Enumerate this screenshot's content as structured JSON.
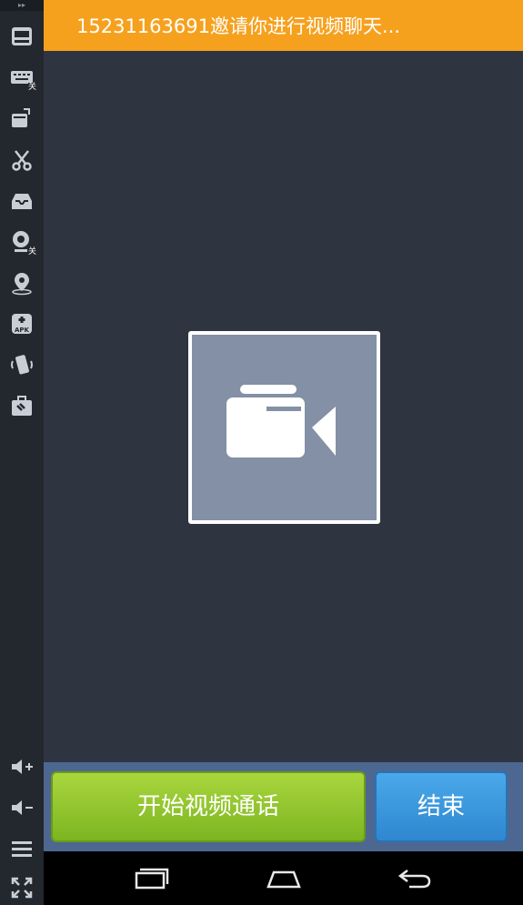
{
  "sidebar": {
    "top_glyph": "▸▸",
    "keyboard_badge": "关",
    "camera_badge": "关",
    "icons": [
      "screen-icon",
      "keyboard-icon",
      "rotate-window-icon",
      "scissors-icon",
      "inbox-icon",
      "webcam-icon",
      "location-icon",
      "apk-install-icon",
      "shake-icon",
      "toolbox-icon",
      "volume-up-icon",
      "volume-down-icon",
      "menu-icon",
      "fullscreen-icon"
    ]
  },
  "header": {
    "title": "15231163691邀请你进行视频聊天..."
  },
  "main": {
    "video_placeholder_icon": "video-camera-icon"
  },
  "actions": {
    "start_label": "开始视频通话",
    "end_label": "结束"
  },
  "navbar": {
    "icons": [
      "recent-apps-icon",
      "home-icon",
      "back-icon"
    ]
  },
  "colors": {
    "header": "#f6a11e",
    "background": "#2f3540",
    "start_button": "#8cc63f",
    "end_button": "#3a97dd",
    "action_bar": "#4d6791"
  }
}
